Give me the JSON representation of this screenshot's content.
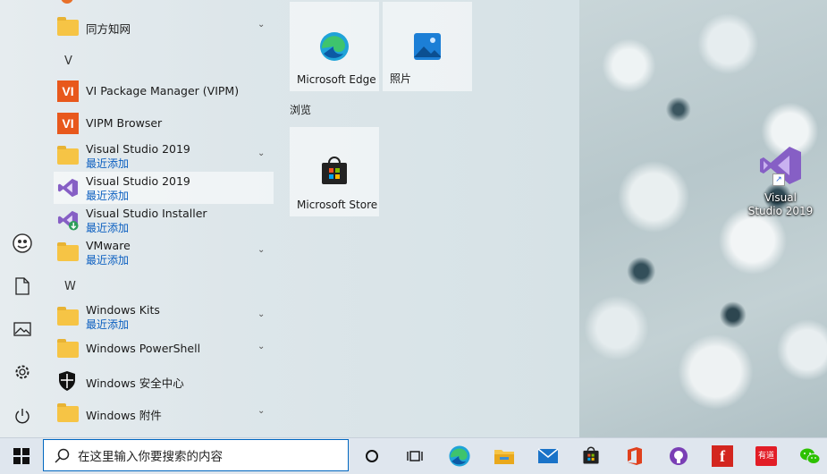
{
  "start_menu": {
    "letters": {
      "v": "V",
      "w": "W"
    },
    "apps": {
      "tongfang": {
        "name": "同方知网"
      },
      "vipm": {
        "name": "VI Package Manager (VIPM)"
      },
      "vipm_browser": {
        "name": "VIPM Browser"
      },
      "vs2019_folder": {
        "name": "Visual Studio 2019",
        "sub": "最近添加"
      },
      "vs2019": {
        "name": "Visual Studio 2019",
        "sub": "最近添加"
      },
      "vs_installer": {
        "name": "Visual Studio Installer",
        "sub": "最近添加"
      },
      "vmware": {
        "name": "VMware",
        "sub": "最近添加"
      },
      "windows_kits": {
        "name": "Windows Kits",
        "sub": "最近添加"
      },
      "powershell": {
        "name": "Windows PowerShell"
      },
      "security": {
        "name": "Windows 安全中心"
      },
      "accessories": {
        "name": "Windows 附件"
      }
    },
    "tiles": {
      "edge": "Microsoft Edge",
      "photos": "照片",
      "group_browse": "浏览",
      "store": "Microsoft Store"
    },
    "rail_icons": [
      "avatar-icon",
      "document-icon",
      "pictures-icon",
      "settings-icon",
      "power-icon"
    ]
  },
  "desktop": {
    "shortcut": {
      "line1": "Visual",
      "line2": "Studio 2019"
    }
  },
  "taskbar": {
    "search": {
      "value": "在这里输入你要搜索的内容"
    },
    "pinned": [
      "cortana-icon",
      "task-view-icon",
      "edge-icon",
      "file-explorer-icon",
      "mail-icon",
      "store-icon",
      "office-icon",
      "github-icon",
      "foxit-icon",
      "youdao-icon",
      "wechat-icon"
    ],
    "youdao_label": "有道"
  },
  "colors": {
    "accent": "#0067c0",
    "recent": "#0b5fc0",
    "vs_purple": "#865fc5"
  }
}
